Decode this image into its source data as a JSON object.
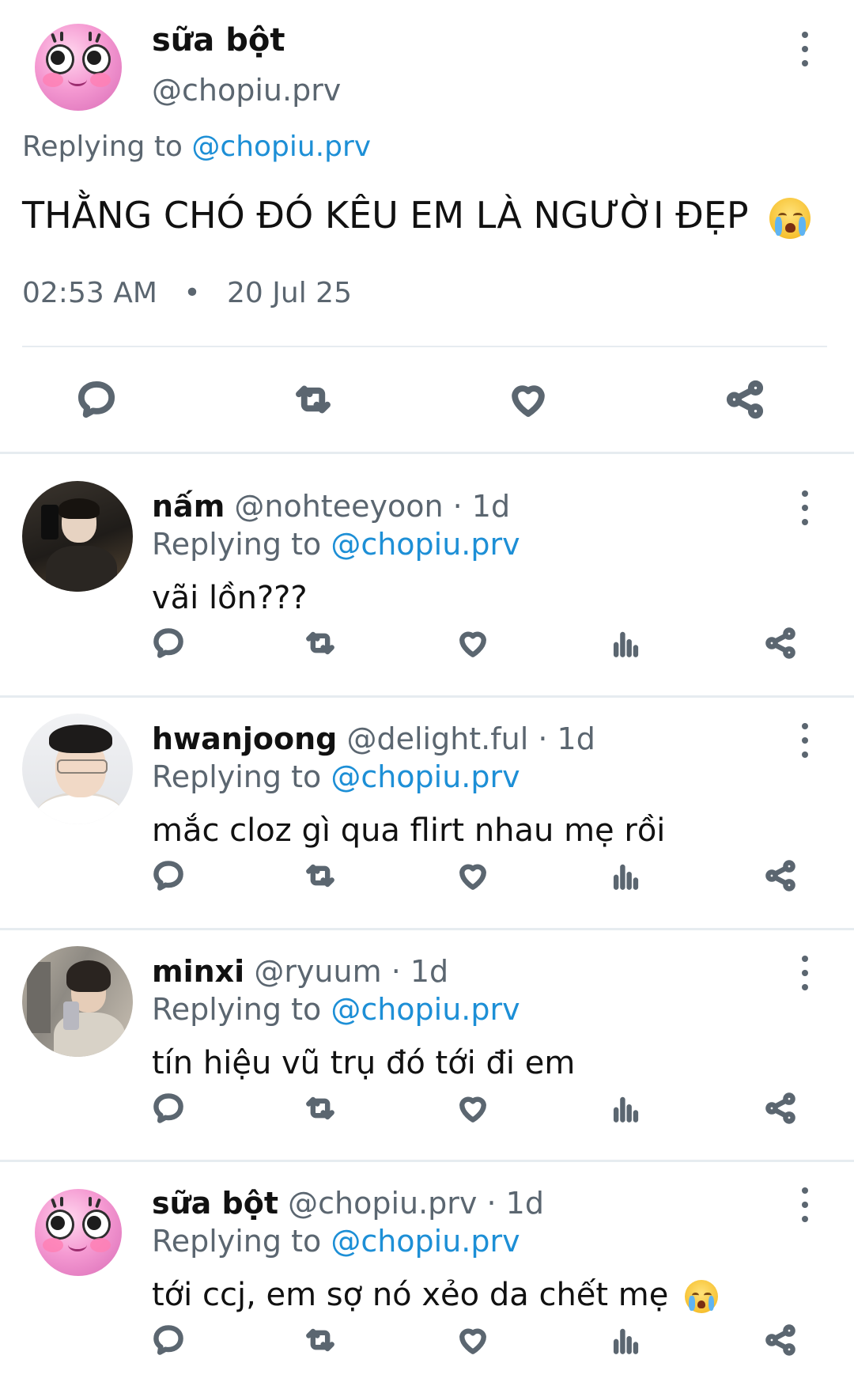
{
  "main_tweet": {
    "name": "sữa bột",
    "handle": "@chopiu.prv",
    "replying_prefix": "Replying to ",
    "replying_to": "@chopiu.prv",
    "text": "THẰNG CHÓ ĐÓ KÊU EM LÀ NGƯỜI ĐẸP",
    "text_emoji": "loudly-crying-face-emoji",
    "time": "02:53 AM",
    "separator": "•",
    "date": "20 Jul 25",
    "actions": [
      "reply-icon",
      "retweet-icon",
      "like-icon",
      "share-icon"
    ]
  },
  "replies": [
    {
      "name": "nấm",
      "handle": "@nohteeyoon",
      "age": "· 1d",
      "replying_prefix": "Replying to ",
      "replying_to": "@chopiu.prv",
      "text": "vãi lồn???"
    },
    {
      "name": "hwanjoong",
      "handle": "@delight.ful",
      "age": "· 1d",
      "replying_prefix": "Replying to ",
      "replying_to": "@chopiu.prv",
      "text": "mắc cloz gì qua flirt nhau mẹ rồi"
    },
    {
      "name": "minxi",
      "handle": "@ryuum",
      "age": "· 1d",
      "replying_prefix": "Replying to ",
      "replying_to": "@chopiu.prv",
      "text": "tín hiệu vũ trụ đó tới đi em"
    },
    {
      "name": "sữa bột",
      "handle": "@chopiu.prv",
      "age": "· 1d",
      "replying_prefix": "Replying to ",
      "replying_to": "@chopiu.prv",
      "text": "tới ccj, em sợ nó xẻo da chết mẹ",
      "text_emoji": "loudly-crying-face-emoji"
    }
  ],
  "reply_actions": [
    "reply-icon",
    "retweet-icon",
    "like-icon",
    "views-icon",
    "share-icon"
  ],
  "colors": {
    "link": "#1d8fd6",
    "secondary_text": "#5b6670",
    "divider": "#e6ecf0"
  }
}
